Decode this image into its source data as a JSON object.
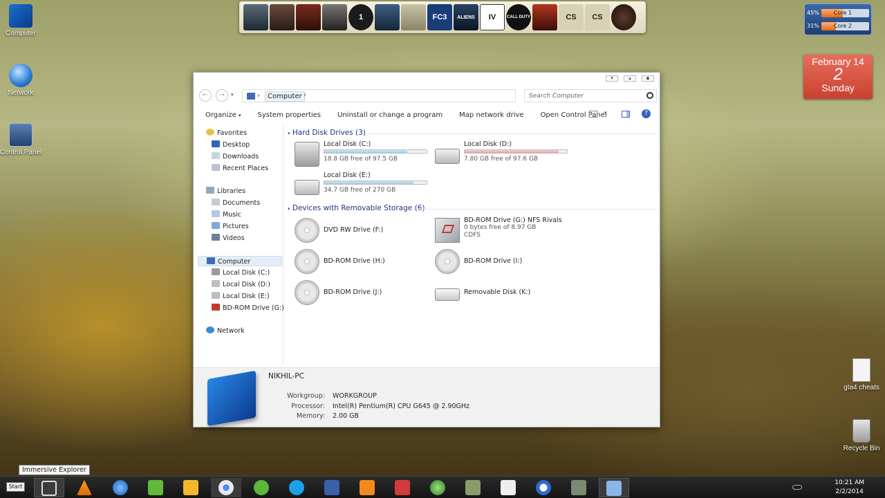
{
  "desktop": {
    "icons": [
      {
        "label": "Computer"
      },
      {
        "label": "Network"
      },
      {
        "label": "Control Panel"
      },
      {
        "label": "gta4 cheats"
      },
      {
        "label": "Recycle Bin"
      }
    ]
  },
  "dock": {
    "games": [
      "",
      "",
      "",
      "",
      "1",
      "",
      "",
      "FC3",
      "ALIENS",
      "IV",
      "CALL DUTY",
      "",
      "CS",
      "CS",
      ""
    ]
  },
  "cpu_gadget": {
    "core1_pct": "45%",
    "core1_label": "Core 1",
    "core2_pct": "31%",
    "core2_label": "Core 2"
  },
  "calendar": {
    "month_day": "February 14",
    "day": "2",
    "weekday": "Sunday"
  },
  "explorer": {
    "address": {
      "crumb": "Computer",
      "sep": "›"
    },
    "search_placeholder": "Search Computer",
    "toolbar": {
      "organize": "Organize",
      "system_properties": "System properties",
      "uninstall": "Uninstall or change a program",
      "map_network": "Map network drive",
      "open_control_panel": "Open Control Panel"
    },
    "nav": {
      "favorites": "Favorites",
      "desktop": "Desktop",
      "downloads": "Downloads",
      "recent": "Recent Places",
      "libraries": "Libraries",
      "documents": "Documents",
      "music": "Music",
      "pictures": "Pictures",
      "videos": "Videos",
      "computer": "Computer",
      "c": "Local Disk (C:)",
      "d": "Local Disk (D:)",
      "e": "Local Disk (E:)",
      "g": "BD-ROM Drive (G:) N",
      "network": "Network"
    },
    "groups": {
      "hdd": "Hard Disk Drives (3)",
      "removable": "Devices with Removable Storage (6)"
    },
    "drives": {
      "c": {
        "name": "Local Disk (C:)",
        "free": "18.8 GB free of 97.5 GB",
        "used_fraction": 0.81
      },
      "d": {
        "name": "Local Disk (D:)",
        "free": "7.80 GB free of 97.6 GB",
        "used_fraction": 0.92
      },
      "e": {
        "name": "Local Disk (E:)",
        "free": "34.7 GB free of 270 GB",
        "used_fraction": 0.87
      },
      "f": {
        "name": "DVD RW Drive (F:)"
      },
      "g": {
        "name": "BD-ROM Drive (G:) NFS Rivals",
        "free": "0 bytes free of 8.97 GB",
        "fs": "CDFS"
      },
      "h": {
        "name": "BD-ROM Drive (H:)"
      },
      "i": {
        "name": "BD-ROM Drive (I:)"
      },
      "j": {
        "name": "BD-ROM Drive (J:)"
      },
      "k": {
        "name": "Removable Disk (K:)"
      }
    },
    "details": {
      "pc_name": "NIKHIL-PC",
      "workgroup_label": "Workgroup:",
      "workgroup": "WORKGROUP",
      "processor_label": "Processor:",
      "processor": "Intel(R) Pentium(R) CPU G645 @ 2.90GHz",
      "memory_label": "Memory:",
      "memory": "2.00 GB"
    }
  },
  "tooltip": "Immersive Explorer",
  "taskbar": {
    "start": "Start",
    "time": "10:21 AM",
    "date": "2/2/2014"
  }
}
